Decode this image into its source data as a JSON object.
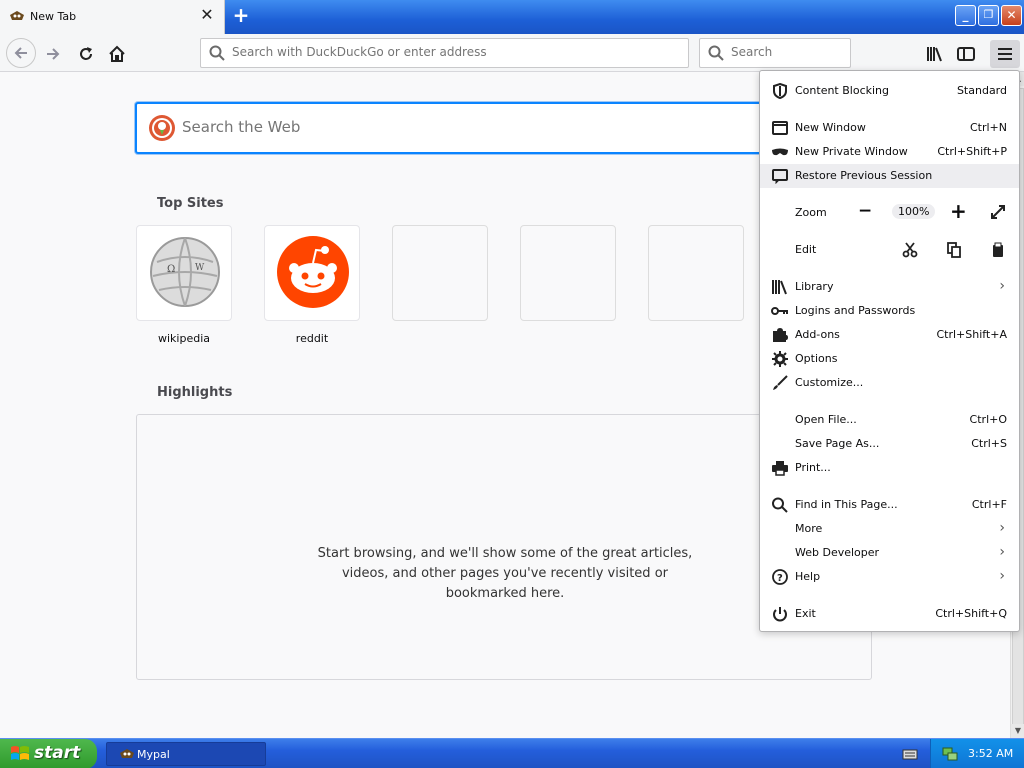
{
  "tab": {
    "title": "New Tab",
    "close": "✕"
  },
  "newtab_label": "+",
  "window_buttons": {
    "minimize": "_",
    "restore": "❐",
    "close": "✕"
  },
  "urlbar": {
    "placeholder": "Search with DuckDuckGo or enter address"
  },
  "searchbar": {
    "placeholder": "Search"
  },
  "bigsearch": {
    "placeholder": "Search the Web"
  },
  "top_sites": {
    "title": "Top Sites",
    "sites": [
      {
        "label": "wikipedia"
      },
      {
        "label": "reddit"
      },
      {
        "label": ""
      },
      {
        "label": ""
      },
      {
        "label": ""
      }
    ]
  },
  "highlights": {
    "title": "Highlights",
    "empty_text": "Start browsing, and we'll show some of the great articles, videos, and other pages you've recently visited or bookmarked here."
  },
  "menu": {
    "content_blocking": {
      "label": "Content Blocking",
      "value": "Standard"
    },
    "new_window": {
      "label": "New Window",
      "shortcut": "Ctrl+N"
    },
    "new_private": {
      "label": "New Private Window",
      "shortcut": "Ctrl+Shift+P"
    },
    "restore": {
      "label": "Restore Previous Session"
    },
    "zoom": {
      "label": "Zoom",
      "minus": "−",
      "value": "100%",
      "plus": "+"
    },
    "edit": {
      "label": "Edit"
    },
    "library": {
      "label": "Library"
    },
    "logins": {
      "label": "Logins and Passwords"
    },
    "addons": {
      "label": "Add-ons",
      "shortcut": "Ctrl+Shift+A"
    },
    "options": {
      "label": "Options"
    },
    "customize": {
      "label": "Customize..."
    },
    "open_file": {
      "label": "Open File...",
      "shortcut": "Ctrl+O"
    },
    "save_page": {
      "label": "Save Page As...",
      "shortcut": "Ctrl+S"
    },
    "print": {
      "label": "Print..."
    },
    "find": {
      "label": "Find in This Page...",
      "shortcut": "Ctrl+F"
    },
    "more": {
      "label": "More"
    },
    "webdev": {
      "label": "Web Developer"
    },
    "help": {
      "label": "Help"
    },
    "exit": {
      "label": "Exit",
      "shortcut": "Ctrl+Shift+Q"
    }
  },
  "taskbar": {
    "start_label": "start",
    "task_item": "Mypal",
    "clock": "3:52 AM"
  },
  "colors": {
    "accent": "#0a84ff",
    "xp_blue": "#245edb",
    "start_green": "#3c9e39",
    "ddg": "#de5833",
    "reddit": "#ff4500"
  },
  "icons": [
    "back-arrow-icon",
    "forward-arrow-icon",
    "reload-icon",
    "home-icon",
    "search-icon",
    "library-icon",
    "sidebar-icon",
    "hamburger-menu-icon",
    "shield-icon",
    "window-icon",
    "mask-icon",
    "restore-icon",
    "cut-icon",
    "copy-icon",
    "paste-icon",
    "fullscreen-icon",
    "key-icon",
    "puzzle-icon",
    "gear-icon",
    "brush-icon",
    "printer-icon",
    "question-icon",
    "power-icon"
  ]
}
